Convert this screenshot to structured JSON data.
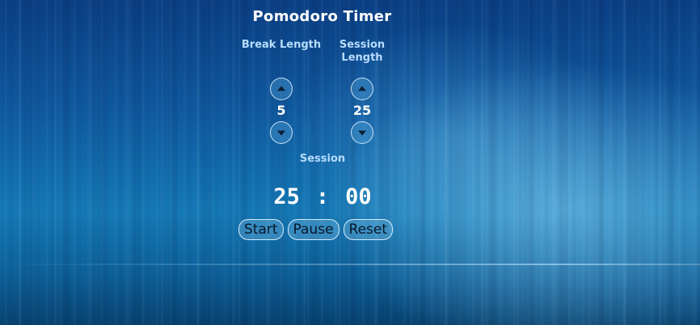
{
  "app": {
    "title": "Pomodoro Timer"
  },
  "break_control": {
    "label": "Break Length",
    "value": "5",
    "increment_icon": "triangle-up-icon",
    "decrement_icon": "triangle-down-icon"
  },
  "session_control": {
    "label": "Session Length",
    "value": "25",
    "increment_icon": "triangle-up-icon",
    "decrement_icon": "triangle-down-icon"
  },
  "timer": {
    "label": "Session",
    "minutes": "25",
    "separator": ":",
    "seconds": "00"
  },
  "buttons": {
    "start": "Start",
    "pause": "Pause",
    "reset": "Reset"
  }
}
